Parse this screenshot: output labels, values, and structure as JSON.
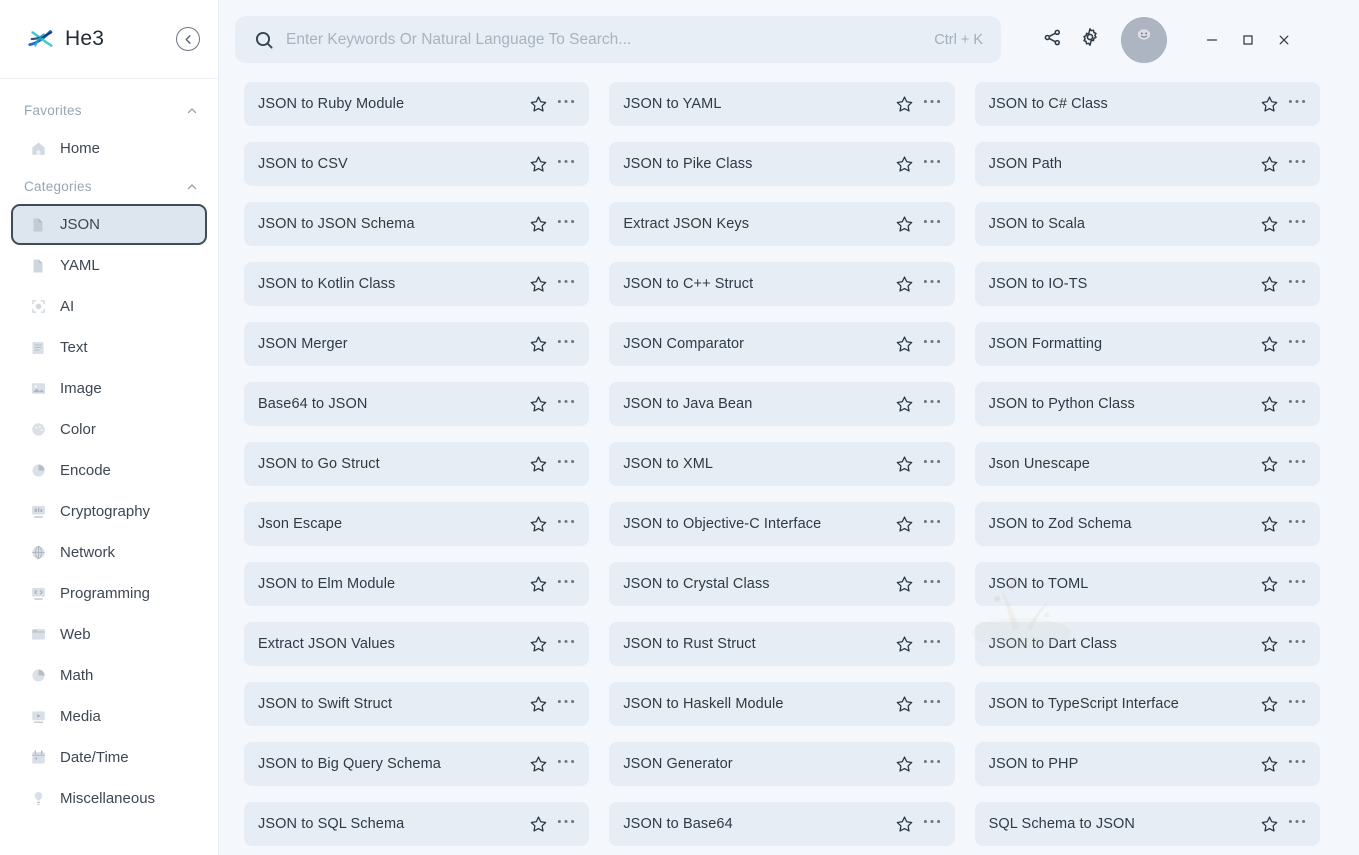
{
  "app": {
    "brand": "He3",
    "logo_colors": {
      "primary": "#1b6fd4",
      "secondary": "#2fc4c8",
      "dark": "#16324f"
    }
  },
  "sidebar": {
    "collapse_icon": "chevron-left-circle-icon",
    "groups": [
      {
        "title": "Favorites",
        "collapse_icon": "chevron-up-icon",
        "items": [
          {
            "label": "Home",
            "icon": "home-icon",
            "selected": false
          }
        ]
      },
      {
        "title": "Categories",
        "collapse_icon": "chevron-up-icon",
        "items": [
          {
            "label": "JSON",
            "icon": "file-icon",
            "selected": true
          },
          {
            "label": "YAML",
            "icon": "file-icon",
            "selected": false
          },
          {
            "label": "AI",
            "icon": "ai-icon",
            "selected": false
          },
          {
            "label": "Text",
            "icon": "text-icon",
            "selected": false
          },
          {
            "label": "Image",
            "icon": "image-icon",
            "selected": false
          },
          {
            "label": "Color",
            "icon": "color-icon",
            "selected": false
          },
          {
            "label": "Encode",
            "icon": "encode-icon",
            "selected": false
          },
          {
            "label": "Cryptography",
            "icon": "crypto-icon",
            "selected": false
          },
          {
            "label": "Network",
            "icon": "network-icon",
            "selected": false
          },
          {
            "label": "Programming",
            "icon": "programming-icon",
            "selected": false
          },
          {
            "label": "Web",
            "icon": "web-icon",
            "selected": false
          },
          {
            "label": "Math",
            "icon": "math-icon",
            "selected": false
          },
          {
            "label": "Media",
            "icon": "media-icon",
            "selected": false
          },
          {
            "label": "Date/Time",
            "icon": "calendar-icon",
            "selected": false
          },
          {
            "label": "Miscellaneous",
            "icon": "misc-icon",
            "selected": false
          }
        ]
      }
    ]
  },
  "topbar": {
    "search": {
      "icon": "search-icon",
      "placeholder": "Enter Keywords Or Natural Language To Search...",
      "value": "",
      "shortcut": "Ctrl + K"
    },
    "actions": [
      {
        "name": "share-icon",
        "title": "Share"
      },
      {
        "name": "gear-icon",
        "title": "Settings"
      }
    ],
    "avatar": {
      "name": "avatar",
      "icon": "user-face-icon"
    },
    "window_controls": [
      {
        "name": "minimize-button",
        "glyph": "—"
      },
      {
        "name": "maximize-button",
        "glyph": "□"
      },
      {
        "name": "close-button",
        "glyph": "✕"
      }
    ]
  },
  "grid": {
    "columns": 3,
    "card_icons": {
      "star": "star-icon",
      "more": "more-options-icon"
    },
    "cards": [
      {
        "title": "JSON to Ruby Module"
      },
      {
        "title": "JSON to YAML"
      },
      {
        "title": "JSON to C# Class"
      },
      {
        "title": "JSON to CSV"
      },
      {
        "title": "JSON to Pike Class"
      },
      {
        "title": "JSON Path"
      },
      {
        "title": "JSON to JSON Schema"
      },
      {
        "title": "Extract JSON Keys"
      },
      {
        "title": "JSON to Scala"
      },
      {
        "title": "JSON to Kotlin Class"
      },
      {
        "title": "JSON to C++ Struct"
      },
      {
        "title": "JSON to IO-TS"
      },
      {
        "title": "JSON Merger"
      },
      {
        "title": "JSON Comparator"
      },
      {
        "title": "JSON Formatting"
      },
      {
        "title": "Base64 to JSON"
      },
      {
        "title": "JSON to Java Bean"
      },
      {
        "title": "JSON to Python Class"
      },
      {
        "title": "JSON to Go Struct"
      },
      {
        "title": "JSON to XML"
      },
      {
        "title": "Json Unescape"
      },
      {
        "title": "Json Escape"
      },
      {
        "title": "JSON to Objective-C Interface"
      },
      {
        "title": "JSON to Zod Schema"
      },
      {
        "title": "JSON to Elm Module"
      },
      {
        "title": "JSON to Crystal Class"
      },
      {
        "title": "JSON to TOML"
      },
      {
        "title": "Extract JSON Values"
      },
      {
        "title": "JSON to Rust Struct"
      },
      {
        "title": "JSON to Dart Class"
      },
      {
        "title": "JSON to Swift Struct"
      },
      {
        "title": "JSON to Haskell Module"
      },
      {
        "title": "JSON to TypeScript Interface"
      },
      {
        "title": "JSON to Big Query Schema"
      },
      {
        "title": "JSON Generator"
      },
      {
        "title": "JSON to PHP"
      },
      {
        "title": "JSON to SQL Schema"
      },
      {
        "title": "JSON to Base64"
      },
      {
        "title": "SQL Schema to JSON"
      }
    ]
  },
  "theme": {
    "page_bg": "#f4f8fc",
    "sidebar_bg": "#ffffff",
    "card_bg": "#e6edf5",
    "search_bg": "#e7eef6",
    "selected_bg": "#dde6ef",
    "selected_border": "#414c59",
    "text": "#2f3a46",
    "muted": "#9aa5b1"
  }
}
